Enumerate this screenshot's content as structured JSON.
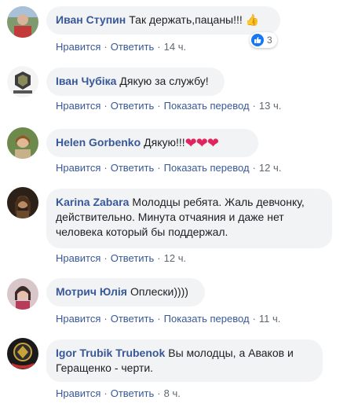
{
  "colors": {
    "bubble_bg": "#f2f3f5",
    "author": "#385898",
    "meta": "#606770",
    "like_blue": "#1877f2",
    "heart": "#e0245e"
  },
  "actions": {
    "like": "Нравится",
    "reply": "Ответить",
    "translate": "Показать перевод",
    "sep": "·"
  },
  "comments": [
    {
      "author": "Иван Ступин",
      "text": "Так держать,пацаны!!! ",
      "emoji": "👍",
      "time": "14 ч.",
      "reactions_count": "3",
      "avatar_icon": "avatar-person-icon"
    },
    {
      "author": "Іван Чубіка",
      "text": "Дякую за службу!",
      "time": "13 ч.",
      "avatar_icon": "avatar-badge-icon"
    },
    {
      "author": "Helen Gorbenko",
      "text": "Дякую!!!",
      "emoji": "❤❤❤",
      "time": "12 ч.",
      "avatar_icon": "avatar-person-icon"
    },
    {
      "author": "Karina Zabara",
      "text": "Молодцы ребята. Жаль девчонку, действительно. Минута отчаяния и даже нет человека который бы поддержал.",
      "time": "12 ч.",
      "avatar_icon": "avatar-person-icon"
    },
    {
      "author": "Мотрич Юлія",
      "text": "Оплески))))",
      "time": "11 ч.",
      "avatar_icon": "avatar-person-icon"
    },
    {
      "author": "Igor Trubik Trubenok",
      "text": "Вы молодцы, а Аваков и Геращенко - черти.",
      "time": "8 ч.",
      "avatar_icon": "avatar-emblem-icon"
    }
  ]
}
